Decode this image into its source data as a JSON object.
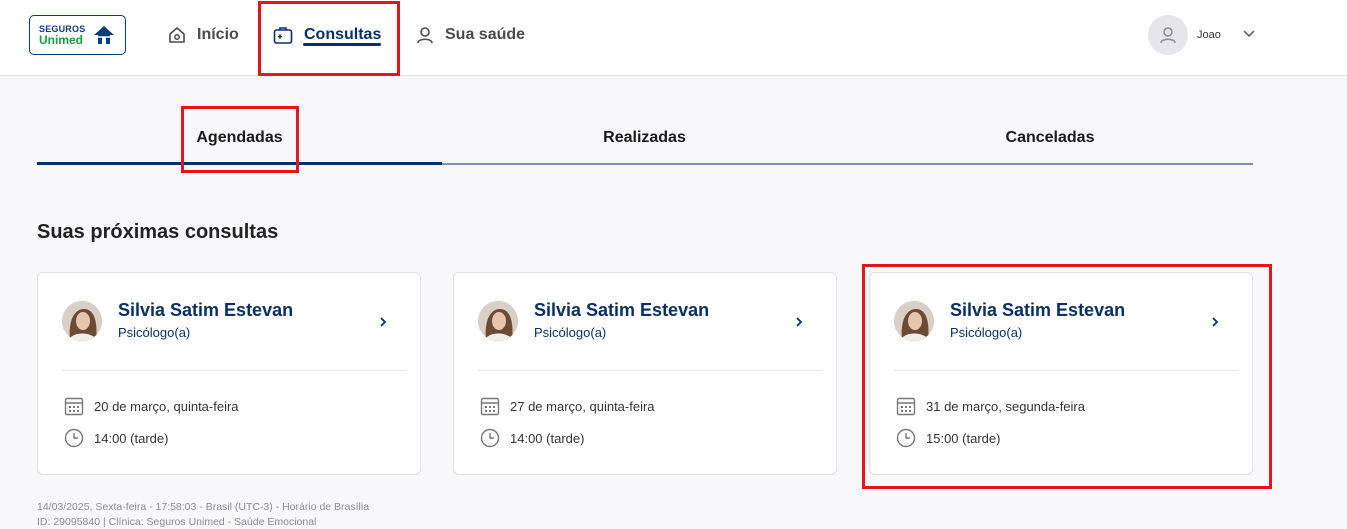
{
  "logo": {
    "line1": "SEGUROS",
    "line2": "Unimed"
  },
  "nav": {
    "inicio": "Início",
    "consultas": "Consultas",
    "saude": "Sua saúde"
  },
  "user": {
    "name": "Joao"
  },
  "tabs": [
    "Agendadas",
    "Realizadas",
    "Canceladas"
  ],
  "section_title": "Suas próximas consultas",
  "cards": [
    {
      "name": "Silvia Satim Estevan",
      "specialty": "Psicólogo(a)",
      "date": "20 de março, quinta-feira",
      "time": "14:00 (tarde)"
    },
    {
      "name": "Silvia Satim Estevan",
      "specialty": "Psicólogo(a)",
      "date": "27 de março, quinta-feira",
      "time": "14:00 (tarde)"
    },
    {
      "name": "Silvia Satim Estevan",
      "specialty": "Psicólogo(a)",
      "date": "31 de março, segunda-feira",
      "time": "15:00 (tarde)"
    }
  ],
  "footer": {
    "line1": "14/03/2025, Sexta-feira - 17:58:03 - Brasil (UTC-3) - Horário de Brasília",
    "line2": "ID: 29095840 | Clínica: Seguros Unimed - Saúde Emocional"
  },
  "colors": {
    "brand_blue": "#0a2f66",
    "brand_green": "#1d9a45",
    "highlight_red": "#e0181d"
  }
}
